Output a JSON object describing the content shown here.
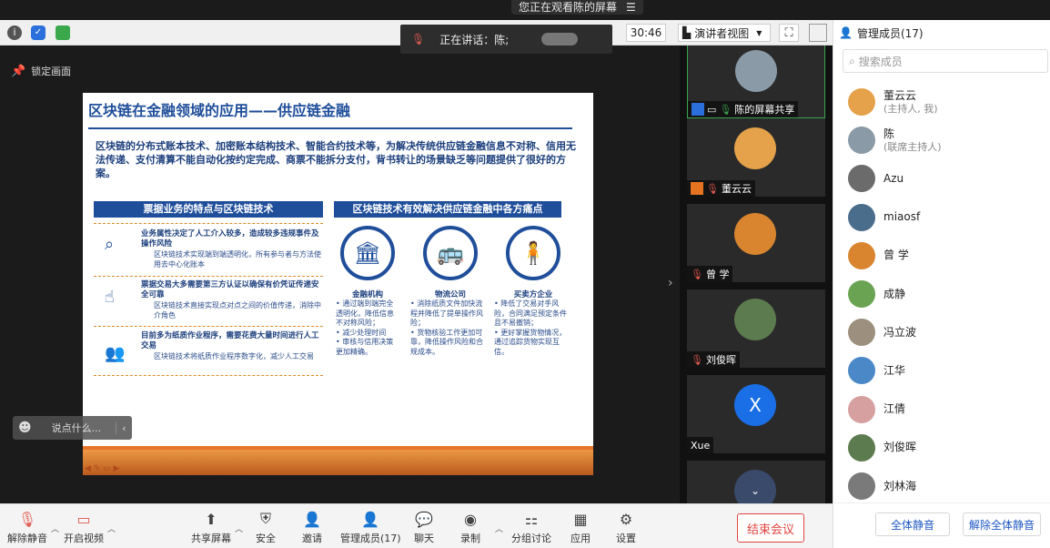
{
  "banner": {
    "viewing_text": "您正在观看陈的屏幕",
    "menu_icon": "menu-icon"
  },
  "toolbar": {
    "speaking_label": "正在讲话：陈;",
    "timer": "30:46",
    "view_mode": "演讲者视图"
  },
  "main": {
    "lock_label": "锁定画面",
    "chat_placeholder": "说点什么...",
    "slide": {
      "title": "区块链在金融领域的应用——供应链金融",
      "intro": "区块链的分布式账本技术、加密账本结构技术、智能合约技术等，为解决传统供应链金融信息不对称、信用无法传递、支付清算不能自动化按约定完成、商票不能拆分支付，背书转让的场景缺乏等问题提供了很好的方案。",
      "left_header": "票据业务的特点与区块链技术",
      "right_header": "区块链技术有效解决供应链金融中各方痛点",
      "left_items": [
        {
          "head": "业务属性决定了人工介入较多，造成较多违规事件及操作风险",
          "body": "区块链技术实现端到端透明化，所有参与者与方法使用去中心化账本"
        },
        {
          "head": "票据交易大多需要第三方认证以确保有价凭证传递安全可靠",
          "body": "区块链技术直接实现点对点之间的价值传递，消除中介角色"
        },
        {
          "head": "目前多为纸质作业程序，需要花费大量时间进行人工交易",
          "body": "区块链技术将纸质作业程序数字化，减少人工交易"
        }
      ],
      "columns": [
        {
          "title": "金融机构",
          "icon": "bank-icon",
          "body": "• 通过端到端完全透明化，降低信息不对称风险；\n• 减少处理时间\n• 审核与信用决策更加精确。"
        },
        {
          "title": "物流公司",
          "icon": "bus-icon",
          "body": "• 消除纸质文件加快流程并降低了提单操作风险；\n• 货物核验工作更加可靠，降低操作风险和合规成本。"
        },
        {
          "title": "买卖方企业",
          "icon": "person-icon",
          "body": "• 降低了交易对手风险，合同满足预定条件且不易撤销；\n• 更好掌握货物情况，通过追踪货物实现互信。"
        }
      ]
    }
  },
  "videos": [
    {
      "name": "陈的屏幕共享"
    },
    {
      "name": "董云云"
    },
    {
      "name": "曾 学"
    },
    {
      "name": "刘俊晖"
    },
    {
      "name": "Xue",
      "initial": "X"
    }
  ],
  "panel": {
    "title": "管理成员(17)",
    "search_placeholder": "搜索成员",
    "members": [
      {
        "name": "董云云",
        "sub": "(主持人, 我)",
        "color": "#e5a24a"
      },
      {
        "name": "陈",
        "sub": "(联席主持人)",
        "color": "#8a9aa6"
      },
      {
        "name": "Azu",
        "sub": "",
        "color": "#6b6b6b"
      },
      {
        "name": "miaosf",
        "sub": "",
        "color": "#4a6d8c"
      },
      {
        "name": "曾 学",
        "sub": "",
        "color": "#d9852f"
      },
      {
        "name": "成静",
        "sub": "",
        "color": "#6aa351"
      },
      {
        "name": "冯立波",
        "sub": "",
        "color": "#9c8f7d"
      },
      {
        "name": "江华",
        "sub": "",
        "color": "#4b88c7"
      },
      {
        "name": "江倩",
        "sub": "",
        "color": "#d6a0a0"
      },
      {
        "name": "刘俊晖",
        "sub": "",
        "color": "#5c7b4e"
      },
      {
        "name": "刘林海",
        "sub": "",
        "color": "#7a7a7a"
      }
    ],
    "mute_all": "全体静音",
    "unmute_all": "解除全体静音"
  },
  "bottom": {
    "mute": "解除静音",
    "video": "开启视频",
    "share": "共享屏幕",
    "security": "安全",
    "invite": "邀请",
    "members": "管理成员(17)",
    "chat": "聊天",
    "record": "录制",
    "breakout": "分组讨论",
    "apps": "应用",
    "settings": "设置",
    "end": "结束会议"
  },
  "colors": {
    "accent": "#1f57c3",
    "danger": "#e0443e",
    "slide_blue": "#1f4e9a",
    "slide_orange": "#e7762b"
  }
}
